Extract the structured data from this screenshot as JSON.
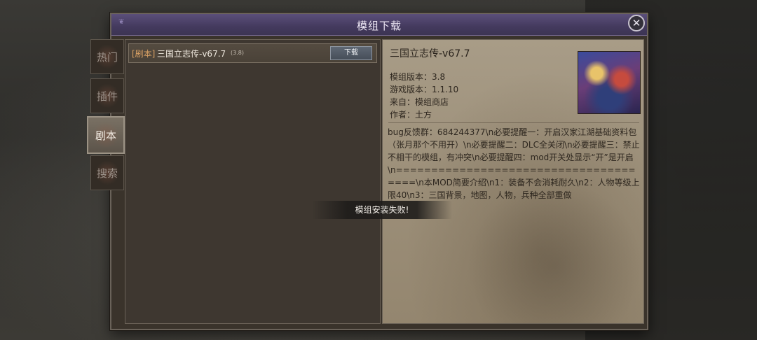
{
  "dialog": {
    "title": "模组下载",
    "close_label": "✕"
  },
  "side_tabs": [
    {
      "label": "热门",
      "active": false
    },
    {
      "label": "插件",
      "active": false
    },
    {
      "label": "剧本",
      "active": true
    },
    {
      "label": "搜索",
      "active": false
    }
  ],
  "mod_list": [
    {
      "tag": "[剧本]",
      "name": "三国立志传-v67.7",
      "version": "(3.8)",
      "download_label": "下载"
    }
  ],
  "detail": {
    "title": "三国立志传-v67.7",
    "mod_version": "模组版本：3.8",
    "game_version": "游戏版本：1.1.10",
    "source": "来自：模组商店",
    "author": "作者：土方",
    "description": "bug反馈群：684244377\\n必要提醒一：开启汉家江湖基础资料包（张月那个不用开）\\n必要提醒二：DLC全关闭\\n必要提醒三：禁止不相干的模组，有冲突\\n必要提醒四：mod开关处显示“开”是开启\\n======================================\\n本MOD简要介绍\\n1：装备不会消耗耐久\\n2：人物等级上限40\\n3：三国背景，地图，人物，兵种全部重做"
  },
  "toast": {
    "message": "模组安装失败!"
  },
  "icons": {
    "close": "close-icon",
    "cover": "mod-cover-image"
  }
}
